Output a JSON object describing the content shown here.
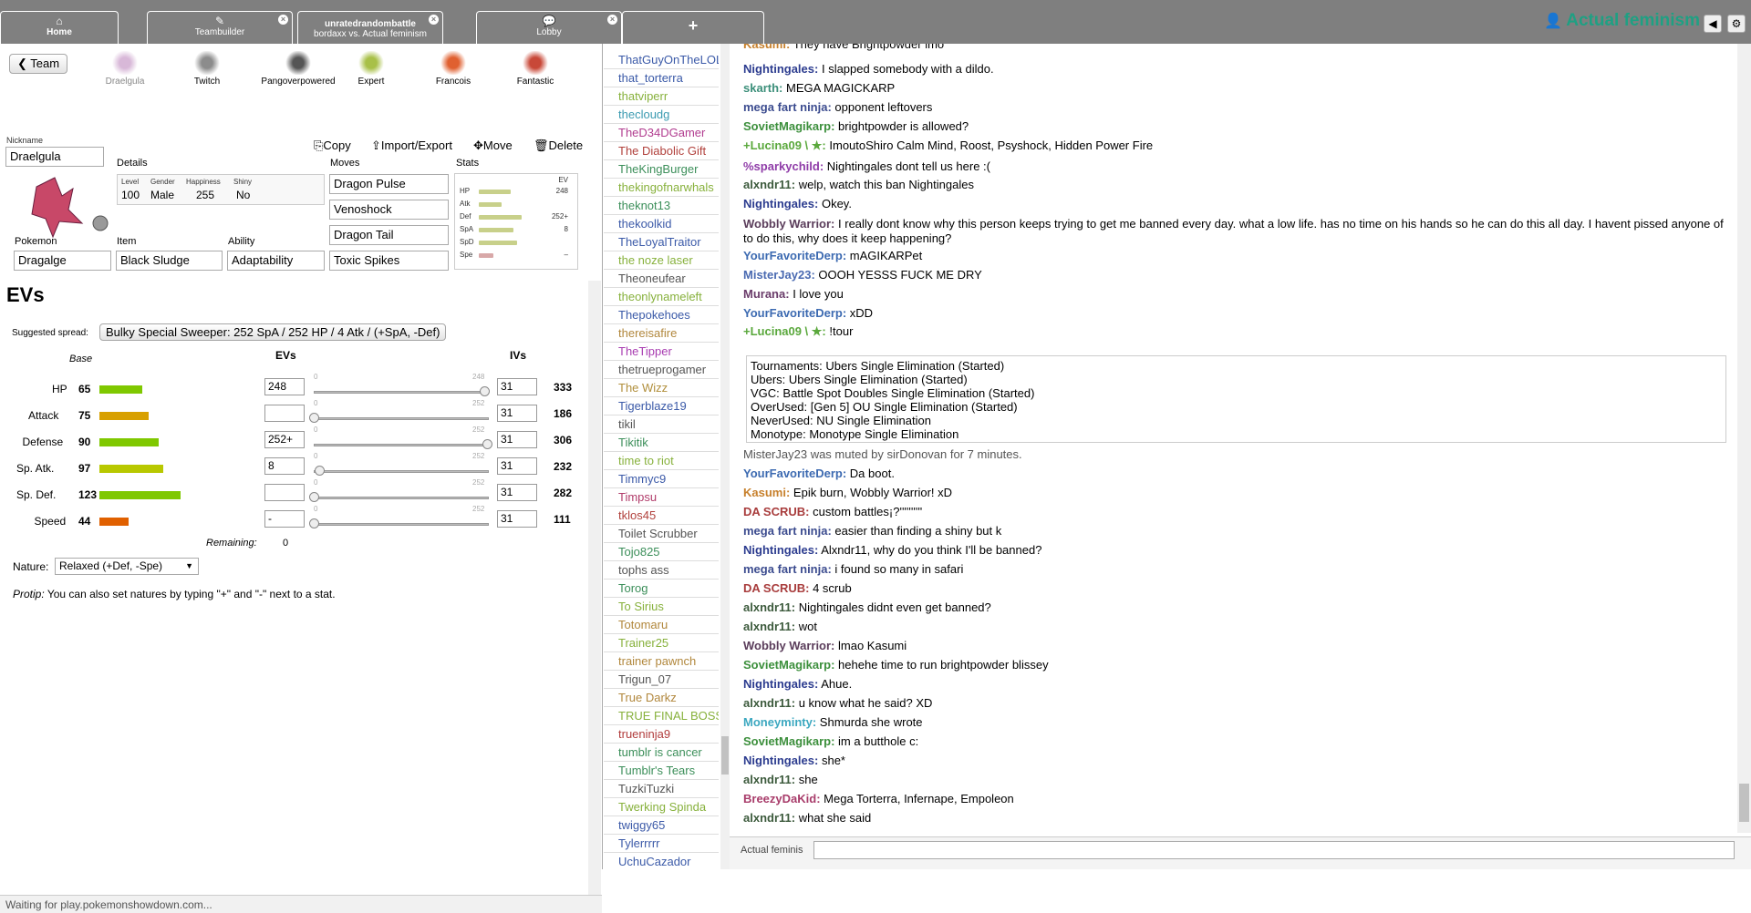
{
  "header": {
    "tabs": [
      {
        "label": "Home",
        "icon": "home-icon",
        "closable": false
      },
      {
        "label": "Teambuilder",
        "icon": "edit-icon",
        "closable": true
      },
      {
        "label": "unratedrandombattle",
        "sublabel": "bordaxx vs. Actual feminism",
        "closable": true
      },
      {
        "label": "Lobby",
        "icon": "chat-icon",
        "closable": true
      },
      {
        "label": "+",
        "closable": false
      }
    ],
    "username": "Actual feminism",
    "sound_icon": "◀",
    "settings_icon": "⚙"
  },
  "teambuilder": {
    "team_button": "Team",
    "slots": [
      "Draelgula",
      "Twitch",
      "Pangoverpowered",
      "Expert",
      "Francois",
      "Fantastic"
    ],
    "actions": {
      "copy": "Copy",
      "import_export": "Import/Export",
      "move": "Move",
      "delete": "Delete"
    },
    "nickname_label": "Nickname",
    "nickname": "Draelgula",
    "details_label": "Details",
    "details": {
      "level_label": "Level",
      "level": "100",
      "gender_label": "Gender",
      "gender": "Male",
      "happiness_label": "Happiness",
      "happiness": "255",
      "shiny_label": "Shiny",
      "shiny": "No"
    },
    "moves_label": "Moves",
    "moves": [
      "Dragon Pulse",
      "Venoshock",
      "Dragon Tail",
      "Toxic Spikes"
    ],
    "stats_label": "Stats",
    "stats_ev_label": "EV",
    "mini_stats": [
      {
        "label": "HP",
        "ev": "248"
      },
      {
        "label": "Atk",
        "ev": ""
      },
      {
        "label": "Def",
        "ev": "252+"
      },
      {
        "label": "SpA",
        "ev": "8"
      },
      {
        "label": "SpD",
        "ev": ""
      },
      {
        "label": "Spe",
        "ev": "–"
      }
    ],
    "pokemon_label": "Pokemon",
    "pokemon": "Dragalge",
    "item_label": "Item",
    "item": "Black Sludge",
    "ability_label": "Ability",
    "ability": "Adaptability",
    "evs_title": "EVs",
    "suggested_label": "Suggested spread:",
    "suggested_spread": "Bulky Special Sweeper: 252 SpA / 252 HP / 4 Atk / (+SpA, -Def)",
    "col_base": "Base",
    "col_evs": "EVs",
    "col_ivs": "IVs",
    "stats": [
      {
        "name": "HP",
        "base": "65",
        "base_value": 65,
        "bar_color": "#7fc800",
        "ev": "248",
        "ev_value": 248,
        "slider_max": "248",
        "iv": "31",
        "total": "333"
      },
      {
        "name": "Attack",
        "base": "75",
        "base_value": 75,
        "bar_color": "#d8a000",
        "ev": "",
        "ev_value": 0,
        "slider_max": "252",
        "iv": "31",
        "total": "186"
      },
      {
        "name": "Defense",
        "base": "90",
        "base_value": 90,
        "bar_color": "#7fc800",
        "ev": "252+",
        "ev_value": 252,
        "slider_max": "252",
        "iv": "31",
        "total": "306"
      },
      {
        "name": "Sp. Atk.",
        "base": "97",
        "base_value": 97,
        "bar_color": "#b8c800",
        "ev": "8",
        "ev_value": 8,
        "slider_max": "252",
        "iv": "31",
        "total": "232"
      },
      {
        "name": "Sp. Def.",
        "base": "123",
        "base_value": 123,
        "bar_color": "#7fc800",
        "ev": "",
        "ev_value": 0,
        "slider_max": "252",
        "iv": "31",
        "total": "282"
      },
      {
        "name": "Speed",
        "base": "44",
        "base_value": 44,
        "bar_color": "#e06000",
        "ev": "-",
        "ev_value": 0,
        "slider_max": "252",
        "iv": "31",
        "total": "111"
      }
    ],
    "remaining_label": "Remaining:",
    "remaining": "0",
    "nature_label": "Nature:",
    "nature": "Relaxed (+Def, -Spe)",
    "protip_label": "Protip:",
    "protip": "You can also set natures by typing \"+\" and \"-\" next to a stat.",
    "status": "Waiting for play.pokemonshowdown.com..."
  },
  "userlist": [
    {
      "name": "ThatGuyOnTheLOL",
      "color": "#3b5aa8"
    },
    {
      "name": "that_torterra",
      "color": "#3b5aa8"
    },
    {
      "name": "thatviperr",
      "color": "#87b13c"
    },
    {
      "name": "thecloudg",
      "color": "#3c9bb1"
    },
    {
      "name": "TheD34DGamer",
      "color": "#b13c8f"
    },
    {
      "name": "The Diabolic Gift",
      "color": "#b1413c"
    },
    {
      "name": "TheKingBurger",
      "color": "#3c8f5a"
    },
    {
      "name": "thekingofnarwhals",
      "color": "#87b13c"
    },
    {
      "name": "theknot13",
      "color": "#3c8f5a"
    },
    {
      "name": "thekoolkid",
      "color": "#3c5aa8"
    },
    {
      "name": "TheLoyalTraitor",
      "color": "#3b5aa8"
    },
    {
      "name": "the noze laser",
      "color": "#87b13c"
    },
    {
      "name": "Theoneufear",
      "color": "#555555"
    },
    {
      "name": "theonlynameleft",
      "color": "#87b13c"
    },
    {
      "name": "Thepokehoes",
      "color": "#3b5aa8"
    },
    {
      "name": "thereisafire",
      "color": "#b1873c"
    },
    {
      "name": "TheTipper",
      "color": "#a83cb1"
    },
    {
      "name": "thetrueprogamer",
      "color": "#555555"
    },
    {
      "name": "The Wizz",
      "color": "#b18f3c"
    },
    {
      "name": "Tigerblaze19",
      "color": "#3b5aa8"
    },
    {
      "name": "tikil",
      "color": "#555555"
    },
    {
      "name": "Tikitik",
      "color": "#3c8f5a"
    },
    {
      "name": "time to riot",
      "color": "#87b13c"
    },
    {
      "name": "Timmyc9",
      "color": "#3c5aa8"
    },
    {
      "name": "Timpsu",
      "color": "#b13c6a"
    },
    {
      "name": "tklos45",
      "color": "#b1413c"
    },
    {
      "name": "Toilet Scrubber",
      "color": "#555555"
    },
    {
      "name": "Tojo825",
      "color": "#3c8f5a"
    },
    {
      "name": "tophs ass",
      "color": "#555555"
    },
    {
      "name": "Torog",
      "color": "#3c8f5a"
    },
    {
      "name": "To Sirius",
      "color": "#87b13c"
    },
    {
      "name": "Totomaru",
      "color": "#b1873c"
    },
    {
      "name": "Trainer25",
      "color": "#87b13c"
    },
    {
      "name": "trainer pawnch",
      "color": "#b1873c"
    },
    {
      "name": "Trigun_07",
      "color": "#555555"
    },
    {
      "name": "True Darkz",
      "color": "#b1873c"
    },
    {
      "name": "TRUE FINAL BOSS",
      "color": "#87b13c"
    },
    {
      "name": "trueninja9",
      "color": "#b13c3c"
    },
    {
      "name": "tumblr is cancer",
      "color": "#3c8f5a"
    },
    {
      "name": "Tumblr's Tears",
      "color": "#3c8f5a"
    },
    {
      "name": "TuzkiTuzki",
      "color": "#555555"
    },
    {
      "name": "Twerking Spinda",
      "color": "#87b13c"
    },
    {
      "name": "twiggy65",
      "color": "#3c5aa8"
    },
    {
      "name": "Tylerrrrr",
      "color": "#3c5aa8"
    },
    {
      "name": "UchuCazador",
      "color": "#3b5aa8"
    }
  ],
  "chat": {
    "messages": [
      {
        "name": "Kasumi:",
        "color": "#c7802c",
        "text": "They have Brightpowder imo"
      },
      {
        "name": "Nightingales:",
        "color": "#2c3c8f",
        "text": "I slapped somebody with a dildo."
      },
      {
        "name": "skarth:",
        "color": "#3c8f7a",
        "text": "MEGA MAGICKARP"
      },
      {
        "name": "mega fart ninja:",
        "color": "#3c4c8f",
        "text": "opponent leftovers"
      },
      {
        "name": "SovietMagikarp:",
        "color": "#3c8f3c",
        "text": "brightpowder is allowed?"
      },
      {
        "name": "+Lucina09 \\ ★:",
        "color": "#5aa83c",
        "text": "ImoutoShiro Calm Mind, Roost, Psyshock, Hidden Power Fire"
      },
      {
        "name": "%sparkychild:",
        "color": "#8f3ca8",
        "text": "Nightingales dont tell us here :("
      },
      {
        "name": "alxndr11:",
        "color": "#3c5a3c",
        "text": "welp, watch this ban Nightingales"
      },
      {
        "name": "Nightingales:",
        "color": "#2c3c8f",
        "text": "Okey."
      },
      {
        "name": "Wobbly Warrior:",
        "color": "#5a3c5a",
        "text": "I really dont know why this person keeps trying to get me banned every day. what a low life. has no time on his hands so he can do this all day. I havent pissed anyone of to do this, why does it keep happening?"
      },
      {
        "name": "YourFavoriteDerp:",
        "color": "#3c6ab1",
        "text": "mAGIKARPet"
      },
      {
        "name": "MisterJay23:",
        "color": "#4a6ab1",
        "text": "OOOH YESSS FUCK ME DRY"
      },
      {
        "name": "Murana:",
        "color": "#6a3c6a",
        "text": "I love you"
      },
      {
        "name": "YourFavoriteDerp:",
        "color": "#3c6ab1",
        "text": "xDD"
      },
      {
        "name": "+Lucina09 \\ ★:",
        "color": "#5aa83c",
        "text": "!tour"
      }
    ],
    "tour_lines": [
      "Tournaments: Ubers Single Elimination (Started)",
      "Ubers: Ubers Single Elimination (Started)",
      "VGC: Battle Spot Doubles Single Elimination (Started)",
      "OverUsed: [Gen 5] OU Single Elimination (Started)",
      "NeverUsed: NU Single Elimination",
      "Monotype: Monotype Single Elimination"
    ],
    "notice": "MisterJay23 was muted by sirDonovan for 7 minutes.",
    "messages2": [
      {
        "name": "YourFavoriteDerp:",
        "color": "#3c6ab1",
        "text": "Da boot."
      },
      {
        "name": "Kasumi:",
        "color": "#c7802c",
        "text": "Epik burn, Wobbly Warrior! xD"
      },
      {
        "name": "DA SCRUB:",
        "color": "#a83c3c",
        "text": "custom battles¡?''''''''''"
      },
      {
        "name": "mega fart ninja:",
        "color": "#3c4c8f",
        "text": "easier than finding a shiny but k"
      },
      {
        "name": "Nightingales:",
        "color": "#2c3c8f",
        "text": "Alxndr11, why do you think I'll be banned?"
      },
      {
        "name": "mega fart ninja:",
        "color": "#3c4c8f",
        "text": "i found so many in safari"
      },
      {
        "name": "DA SCRUB:",
        "color": "#a83c3c",
        "text": "4 scrub"
      },
      {
        "name": "alxndr11:",
        "color": "#3c5a3c",
        "text": "Nightingales didnt even get banned?"
      },
      {
        "name": "alxndr11:",
        "color": "#3c5a3c",
        "text": "wot"
      },
      {
        "name": "Wobbly Warrior:",
        "color": "#5a3c5a",
        "text": "lmao Kasumi"
      },
      {
        "name": "SovietMagikarp:",
        "color": "#3c8f3c",
        "text": "hehehe time to run brightpowder blissey"
      },
      {
        "name": "Nightingales:",
        "color": "#2c3c8f",
        "text": "Ahue."
      },
      {
        "name": "alxndr11:",
        "color": "#3c5a3c",
        "text": "u know what he said? XD"
      },
      {
        "name": "Moneyminty:",
        "color": "#3ca8c0",
        "text": "Shmurda she wrote"
      },
      {
        "name": "SovietMagikarp:",
        "color": "#3c8f3c",
        "text": "im a butthole c:"
      },
      {
        "name": "Nightingales:",
        "color": "#2c3c8f",
        "text": "she*"
      },
      {
        "name": "alxndr11:",
        "color": "#3c5a3c",
        "text": "she"
      },
      {
        "name": "BreezyDaKid:",
        "color": "#a83c6a",
        "text": "Mega Torterra, Infernape, Empoleon"
      },
      {
        "name": "alxndr11:",
        "color": "#3c5a3c",
        "text": "what she said"
      }
    ],
    "input_name": "Actual feminis"
  }
}
